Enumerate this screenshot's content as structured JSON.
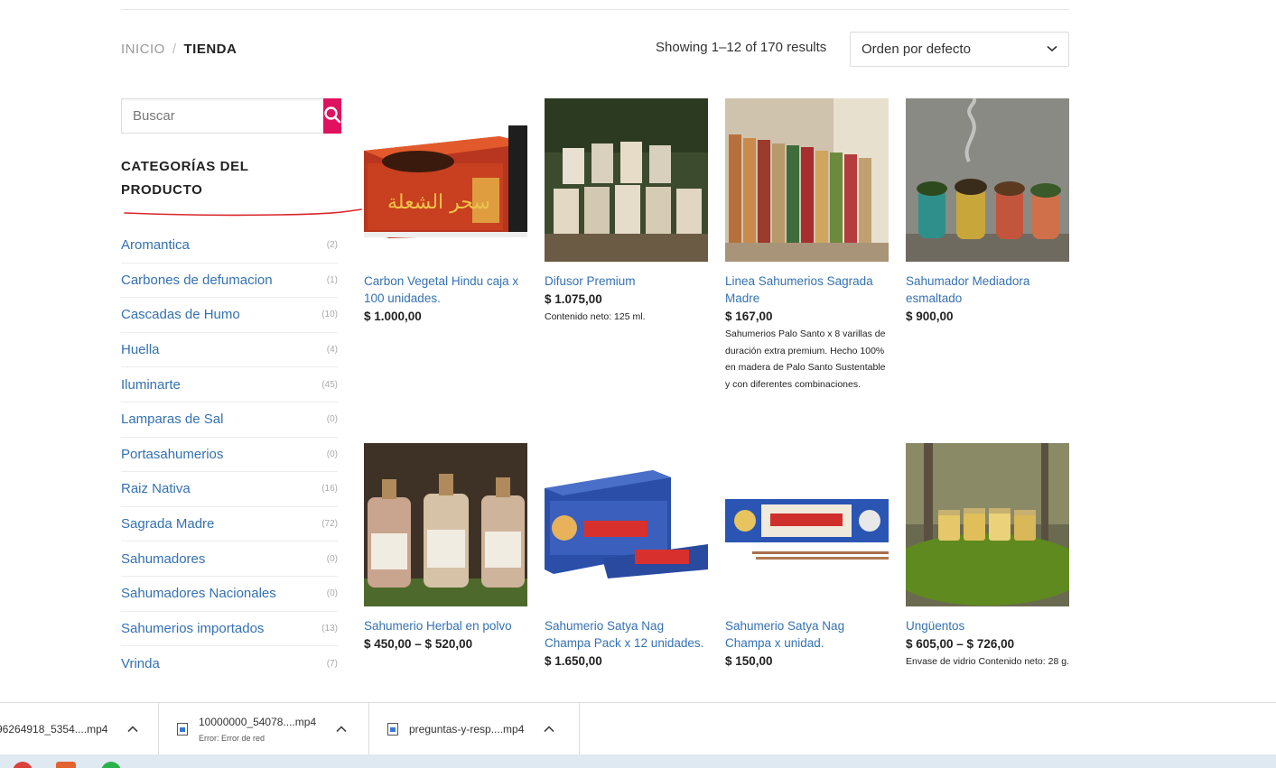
{
  "breadcrumb": {
    "home": "INICIO",
    "separator": "/",
    "current": "TIENDA"
  },
  "results": {
    "text": "Showing 1–12 of 170 results"
  },
  "orderby": {
    "selected": "Orden por defecto"
  },
  "search": {
    "placeholder": "Buscar"
  },
  "sidebar": {
    "title_line1": "CATEGORÍAS DEL",
    "title_line2": "PRODUCTO",
    "categories": [
      {
        "name": "Aromantica",
        "count": "(2)"
      },
      {
        "name": "Carbones de defumacion",
        "count": "(1)"
      },
      {
        "name": "Cascadas de Humo",
        "count": "(10)"
      },
      {
        "name": "Huella",
        "count": "(4)"
      },
      {
        "name": "Iluminarte",
        "count": "(45)"
      },
      {
        "name": "Lamparas de Sal",
        "count": "(0)"
      },
      {
        "name": "Portasahumerios",
        "count": "(0)"
      },
      {
        "name": "Raiz Nativa",
        "count": "(16)"
      },
      {
        "name": "Sagrada Madre",
        "count": "(72)"
      },
      {
        "name": "Sahumadores",
        "count": "(0)"
      },
      {
        "name": "Sahumadores Nacionales",
        "count": "(0)"
      },
      {
        "name": "Sahumerios importados",
        "count": "(13)"
      },
      {
        "name": "Vrinda",
        "count": "(7)"
      }
    ]
  },
  "products": [
    {
      "name": "Carbon Vegetal Hindu caja x 100 unidades.",
      "price": "$ 1.000,00",
      "desc": ""
    },
    {
      "name": "Difusor Premium",
      "price": "$ 1.075,00",
      "desc": "Contenido neto: 125 ml."
    },
    {
      "name": "Linea Sahumerios Sagrada Madre",
      "price": "$ 167,00",
      "desc": "Sahumerios Palo Santo x 8 varillas de duración extra premium. Hecho 100% en madera de Palo Santo Sustentable y con diferentes combinaciones."
    },
    {
      "name": "Sahumador Mediadora esmaltado",
      "price": "$ 900,00",
      "desc": ""
    },
    {
      "name": "Sahumerio Herbal en polvo",
      "price": "$ 450,00 – $ 520,00",
      "desc": ""
    },
    {
      "name": "Sahumerio Satya Nag Champa Pack x 12 unidades.",
      "price": "$ 1.650,00",
      "desc": ""
    },
    {
      "name": "Sahumerio Satya Nag Champa x unidad.",
      "price": "$ 150,00",
      "desc": ""
    },
    {
      "name": "Ungüentos",
      "price": "$ 605,00 – $ 726,00",
      "desc": "Envase de vidrio Contenido neto: 28 g."
    }
  ],
  "downloads": [
    {
      "file": "96264918_5354....mp4",
      "status": ""
    },
    {
      "file": "10000000_54078....mp4",
      "status": "Error: Error de red"
    },
    {
      "file": "preguntas-y-resp....mp4",
      "status": ""
    }
  ],
  "colors": {
    "accent": "#e0115f",
    "link": "#3471b3",
    "underline": "#d9262b"
  }
}
